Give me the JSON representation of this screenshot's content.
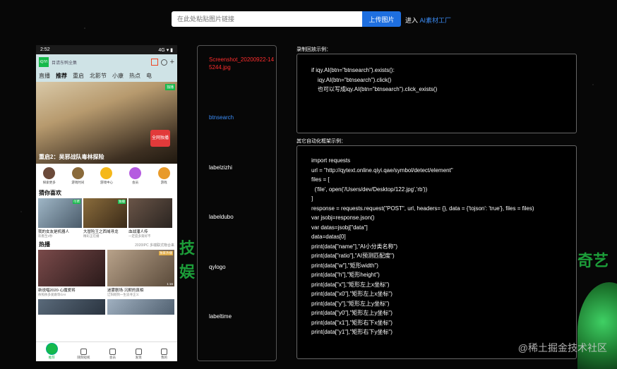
{
  "search": {
    "placeholder": "在此处粘贴图片链接",
    "upload_label": "上传图片",
    "enter_prefix": "进入 ",
    "enter_link": "AI素材工厂"
  },
  "phone": {
    "time": "2:52",
    "status_right": "4G ▾ ▮",
    "app_search": "目请东鸭全集",
    "nav_items": [
      "直播",
      "推荐",
      "重启",
      "北影节",
      "小康",
      "热点",
      "电"
    ],
    "hero_tag": "独播",
    "hero_badge": "全网独播",
    "hero_title": "重启2：吴邪战队毒林探险",
    "quick_items": [
      "探索更多",
      "游戏时间",
      "游戏中心",
      "会员",
      "游戏"
    ],
    "guess_title": "猜你喜欢",
    "guess_cards": [
      {
        "title": "我的女友是机器人",
        "sub": "欢看至2秒",
        "badge": "付费"
      },
      {
        "title": "大冒险王之西域寻龙",
        "sub": "精彩正在播",
        "badge": "独播"
      },
      {
        "title": "血战潘人传",
        "sub": "一定度多第好不",
        "badge": ""
      }
    ],
    "hot_title": "热播",
    "hot_sub": "2020IPC 多端联式物合来",
    "hot_cards": [
      {
        "title": "新说唱2020·心魔爱将",
        "sub": "依照依多爱跟等GAI",
        "dur": "",
        "badge": ""
      },
      {
        "title": "迷雾剧场·沉默的真相",
        "sub": "辽阳刚到一生追寻正义",
        "dur": "1:16",
        "badge": "独家热播"
      }
    ],
    "tabs": [
      "推荐",
      "随刻短视",
      "会员",
      "发现",
      "我的"
    ]
  },
  "list": {
    "items": [
      "Screenshot_20200922-145244.jpg",
      "btnsearch",
      "labelzizhi",
      "labeldubo",
      "qylogo",
      "labeltime"
    ]
  },
  "code1": {
    "label": "录制回放示例：",
    "lines": [
      "if iqy.AI(btn=\"btnsearch\").exists():",
      "    iqy.AI(btn=\"btnsearch\").click()",
      "    也可以写成iqy.AI(btn=\"btnsearch\").click_exists()"
    ]
  },
  "code2": {
    "label": "其它自动化框架示例：",
    "lines": [
      "import requests",
      "url = \"http://qytext.online.qiyi.qae/symbol/detect/element\"",
      "files = [",
      "  ('file', open('/Users/dev/Desktop/122.jpg','rb'))",
      "]",
      "response = requests.request(\"POST\", url, headers= {}, data = {'tojson': 'true'}, files = files)",
      "var jsobj=response.json()",
      "var datas=jsobj[\"data\"]",
      "data=datas[0]",
      "print(data[\"name\"],\"AI小分类名称\")",
      "print(data[\"ratio\"],\"AI预测匹配度\")",
      "print(data[\"w\"],\"矩形width\")",
      "print(data[\"h\"],\"矩形height\")",
      "print(data[\"x\"],\"矩形左上x坐标\")",
      "print(data[\"x0\"],\"矩形左上x坐标\")",
      "print(data[\"y\"],\"矩形左上y坐标\")",
      "print(data[\"y0\"],\"矩形左上y坐标\")",
      "print(data[\"x1\"],\"矩形右下x坐标\")",
      "print(data[\"y1\"],\"矩形右下y坐标\")"
    ]
  },
  "background": {
    "left_text_1": "技",
    "left_text_2": "娱",
    "right_text": "奇艺",
    "watermark": "@稀土掘金技术社区"
  }
}
